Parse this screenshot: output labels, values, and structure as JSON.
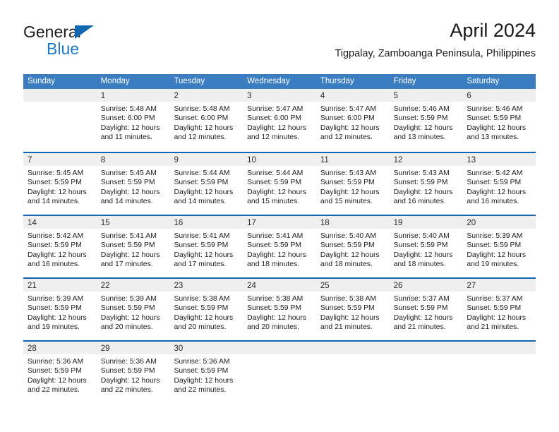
{
  "brand": {
    "name_part1": "General",
    "name_part2": "Blue",
    "accent_color": "#1267b2",
    "blue_text_color": "#1c7ac7"
  },
  "header": {
    "title": "April 2024",
    "subtitle": "Tigpalay, Zamboanga Peninsula, Philippines"
  },
  "calendar": {
    "header_bg": "#3a7dc0",
    "row_border_color": "#1267b2",
    "daynum_band_bg": "#efefef",
    "weekdays": [
      "Sunday",
      "Monday",
      "Tuesday",
      "Wednesday",
      "Thursday",
      "Friday",
      "Saturday"
    ],
    "weeks": [
      [
        {
          "day": ""
        },
        {
          "day": "1",
          "sunrise": "Sunrise: 5:48 AM",
          "sunset": "Sunset: 6:00 PM",
          "daylight_1": "Daylight: 12 hours",
          "daylight_2": "and 11 minutes."
        },
        {
          "day": "2",
          "sunrise": "Sunrise: 5:48 AM",
          "sunset": "Sunset: 6:00 PM",
          "daylight_1": "Daylight: 12 hours",
          "daylight_2": "and 12 minutes."
        },
        {
          "day": "3",
          "sunrise": "Sunrise: 5:47 AM",
          "sunset": "Sunset: 6:00 PM",
          "daylight_1": "Daylight: 12 hours",
          "daylight_2": "and 12 minutes."
        },
        {
          "day": "4",
          "sunrise": "Sunrise: 5:47 AM",
          "sunset": "Sunset: 6:00 PM",
          "daylight_1": "Daylight: 12 hours",
          "daylight_2": "and 12 minutes."
        },
        {
          "day": "5",
          "sunrise": "Sunrise: 5:46 AM",
          "sunset": "Sunset: 5:59 PM",
          "daylight_1": "Daylight: 12 hours",
          "daylight_2": "and 13 minutes."
        },
        {
          "day": "6",
          "sunrise": "Sunrise: 5:46 AM",
          "sunset": "Sunset: 5:59 PM",
          "daylight_1": "Daylight: 12 hours",
          "daylight_2": "and 13 minutes."
        }
      ],
      [
        {
          "day": "7",
          "sunrise": "Sunrise: 5:45 AM",
          "sunset": "Sunset: 5:59 PM",
          "daylight_1": "Daylight: 12 hours",
          "daylight_2": "and 14 minutes."
        },
        {
          "day": "8",
          "sunrise": "Sunrise: 5:45 AM",
          "sunset": "Sunset: 5:59 PM",
          "daylight_1": "Daylight: 12 hours",
          "daylight_2": "and 14 minutes."
        },
        {
          "day": "9",
          "sunrise": "Sunrise: 5:44 AM",
          "sunset": "Sunset: 5:59 PM",
          "daylight_1": "Daylight: 12 hours",
          "daylight_2": "and 14 minutes."
        },
        {
          "day": "10",
          "sunrise": "Sunrise: 5:44 AM",
          "sunset": "Sunset: 5:59 PM",
          "daylight_1": "Daylight: 12 hours",
          "daylight_2": "and 15 minutes."
        },
        {
          "day": "11",
          "sunrise": "Sunrise: 5:43 AM",
          "sunset": "Sunset: 5:59 PM",
          "daylight_1": "Daylight: 12 hours",
          "daylight_2": "and 15 minutes."
        },
        {
          "day": "12",
          "sunrise": "Sunrise: 5:43 AM",
          "sunset": "Sunset: 5:59 PM",
          "daylight_1": "Daylight: 12 hours",
          "daylight_2": "and 16 minutes."
        },
        {
          "day": "13",
          "sunrise": "Sunrise: 5:42 AM",
          "sunset": "Sunset: 5:59 PM",
          "daylight_1": "Daylight: 12 hours",
          "daylight_2": "and 16 minutes."
        }
      ],
      [
        {
          "day": "14",
          "sunrise": "Sunrise: 5:42 AM",
          "sunset": "Sunset: 5:59 PM",
          "daylight_1": "Daylight: 12 hours",
          "daylight_2": "and 16 minutes."
        },
        {
          "day": "15",
          "sunrise": "Sunrise: 5:41 AM",
          "sunset": "Sunset: 5:59 PM",
          "daylight_1": "Daylight: 12 hours",
          "daylight_2": "and 17 minutes."
        },
        {
          "day": "16",
          "sunrise": "Sunrise: 5:41 AM",
          "sunset": "Sunset: 5:59 PM",
          "daylight_1": "Daylight: 12 hours",
          "daylight_2": "and 17 minutes."
        },
        {
          "day": "17",
          "sunrise": "Sunrise: 5:41 AM",
          "sunset": "Sunset: 5:59 PM",
          "daylight_1": "Daylight: 12 hours",
          "daylight_2": "and 18 minutes."
        },
        {
          "day": "18",
          "sunrise": "Sunrise: 5:40 AM",
          "sunset": "Sunset: 5:59 PM",
          "daylight_1": "Daylight: 12 hours",
          "daylight_2": "and 18 minutes."
        },
        {
          "day": "19",
          "sunrise": "Sunrise: 5:40 AM",
          "sunset": "Sunset: 5:59 PM",
          "daylight_1": "Daylight: 12 hours",
          "daylight_2": "and 18 minutes."
        },
        {
          "day": "20",
          "sunrise": "Sunrise: 5:39 AM",
          "sunset": "Sunset: 5:59 PM",
          "daylight_1": "Daylight: 12 hours",
          "daylight_2": "and 19 minutes."
        }
      ],
      [
        {
          "day": "21",
          "sunrise": "Sunrise: 5:39 AM",
          "sunset": "Sunset: 5:59 PM",
          "daylight_1": "Daylight: 12 hours",
          "daylight_2": "and 19 minutes."
        },
        {
          "day": "22",
          "sunrise": "Sunrise: 5:39 AM",
          "sunset": "Sunset: 5:59 PM",
          "daylight_1": "Daylight: 12 hours",
          "daylight_2": "and 20 minutes."
        },
        {
          "day": "23",
          "sunrise": "Sunrise: 5:38 AM",
          "sunset": "Sunset: 5:59 PM",
          "daylight_1": "Daylight: 12 hours",
          "daylight_2": "and 20 minutes."
        },
        {
          "day": "24",
          "sunrise": "Sunrise: 5:38 AM",
          "sunset": "Sunset: 5:59 PM",
          "daylight_1": "Daylight: 12 hours",
          "daylight_2": "and 20 minutes."
        },
        {
          "day": "25",
          "sunrise": "Sunrise: 5:38 AM",
          "sunset": "Sunset: 5:59 PM",
          "daylight_1": "Daylight: 12 hours",
          "daylight_2": "and 21 minutes."
        },
        {
          "day": "26",
          "sunrise": "Sunrise: 5:37 AM",
          "sunset": "Sunset: 5:59 PM",
          "daylight_1": "Daylight: 12 hours",
          "daylight_2": "and 21 minutes."
        },
        {
          "day": "27",
          "sunrise": "Sunrise: 5:37 AM",
          "sunset": "Sunset: 5:59 PM",
          "daylight_1": "Daylight: 12 hours",
          "daylight_2": "and 21 minutes."
        }
      ],
      [
        {
          "day": "28",
          "sunrise": "Sunrise: 5:36 AM",
          "sunset": "Sunset: 5:59 PM",
          "daylight_1": "Daylight: 12 hours",
          "daylight_2": "and 22 minutes."
        },
        {
          "day": "29",
          "sunrise": "Sunrise: 5:36 AM",
          "sunset": "Sunset: 5:59 PM",
          "daylight_1": "Daylight: 12 hours",
          "daylight_2": "and 22 minutes."
        },
        {
          "day": "30",
          "sunrise": "Sunrise: 5:36 AM",
          "sunset": "Sunset: 5:59 PM",
          "daylight_1": "Daylight: 12 hours",
          "daylight_2": "and 22 minutes."
        },
        {
          "day": ""
        },
        {
          "day": ""
        },
        {
          "day": ""
        },
        {
          "day": ""
        }
      ]
    ]
  }
}
